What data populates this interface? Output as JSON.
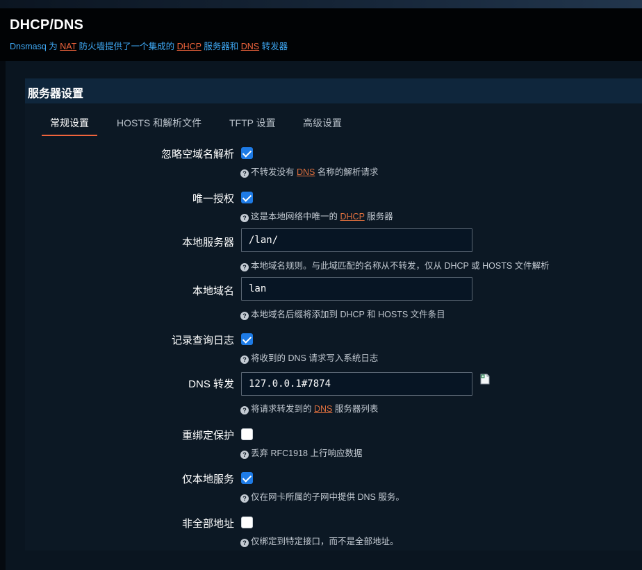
{
  "header": {
    "title": "DHCP/DNS",
    "desc_pre": "Dnsmasq 为 ",
    "desc_nat": "NAT",
    "desc_mid1": " 防火墙提供了一个集成的 ",
    "desc_dhcp": "DHCP",
    "desc_mid2": " 服务器和 ",
    "desc_dns": "DNS",
    "desc_post": " 转发器"
  },
  "panel": {
    "title": "服务器设置"
  },
  "tabs": [
    {
      "label": "常规设置",
      "active": true
    },
    {
      "label": "HOSTS 和解析文件",
      "active": false
    },
    {
      "label": "TFTP 设置",
      "active": false
    },
    {
      "label": "高级设置",
      "active": false
    }
  ],
  "fields": {
    "domainneeded": {
      "label": "忽略空域名解析",
      "checked": true,
      "help_pre": "不转发没有 ",
      "help_abbr": "DNS",
      "help_post": " 名称的解析请求"
    },
    "authoritative": {
      "label": "唯一授权",
      "checked": true,
      "help_pre": "这是本地网络中唯一的 ",
      "help_abbr": "DHCP",
      "help_post": " 服务器"
    },
    "local": {
      "label": "本地服务器",
      "value": "/lan/",
      "help": "本地域名规则。与此域匹配的名称从不转发，仅从 DHCP 或 HOSTS 文件解析"
    },
    "domain": {
      "label": "本地域名",
      "value": "lan",
      "help": "本地域名后缀将添加到 DHCP 和 HOSTS 文件条目"
    },
    "logqueries": {
      "label": "记录查询日志",
      "checked": true,
      "help": "将收到的 DNS 请求写入系统日志"
    },
    "server": {
      "label": "DNS 转发",
      "value": "127.0.0.1#7874",
      "help_pre": "将请求转发到的 ",
      "help_abbr": "DNS",
      "help_post": " 服务器列表"
    },
    "rebind_protection": {
      "label": "重绑定保护",
      "checked": false,
      "help": "丢弃 RFC1918 上行响应数据"
    },
    "localservice": {
      "label": "仅本地服务",
      "checked": true,
      "help": "仅在网卡所属的子网中提供 DNS 服务。"
    },
    "nonwildcard": {
      "label": "非全部地址",
      "checked": false,
      "help": "仅绑定到特定接口，而不是全部地址。"
    }
  },
  "icons": {
    "help": "question-circle-icon",
    "add": "add-entry-icon"
  },
  "colors": {
    "accent": "#f0643c",
    "link": "#3fa9f5",
    "checkbox": "#1e7be6"
  }
}
